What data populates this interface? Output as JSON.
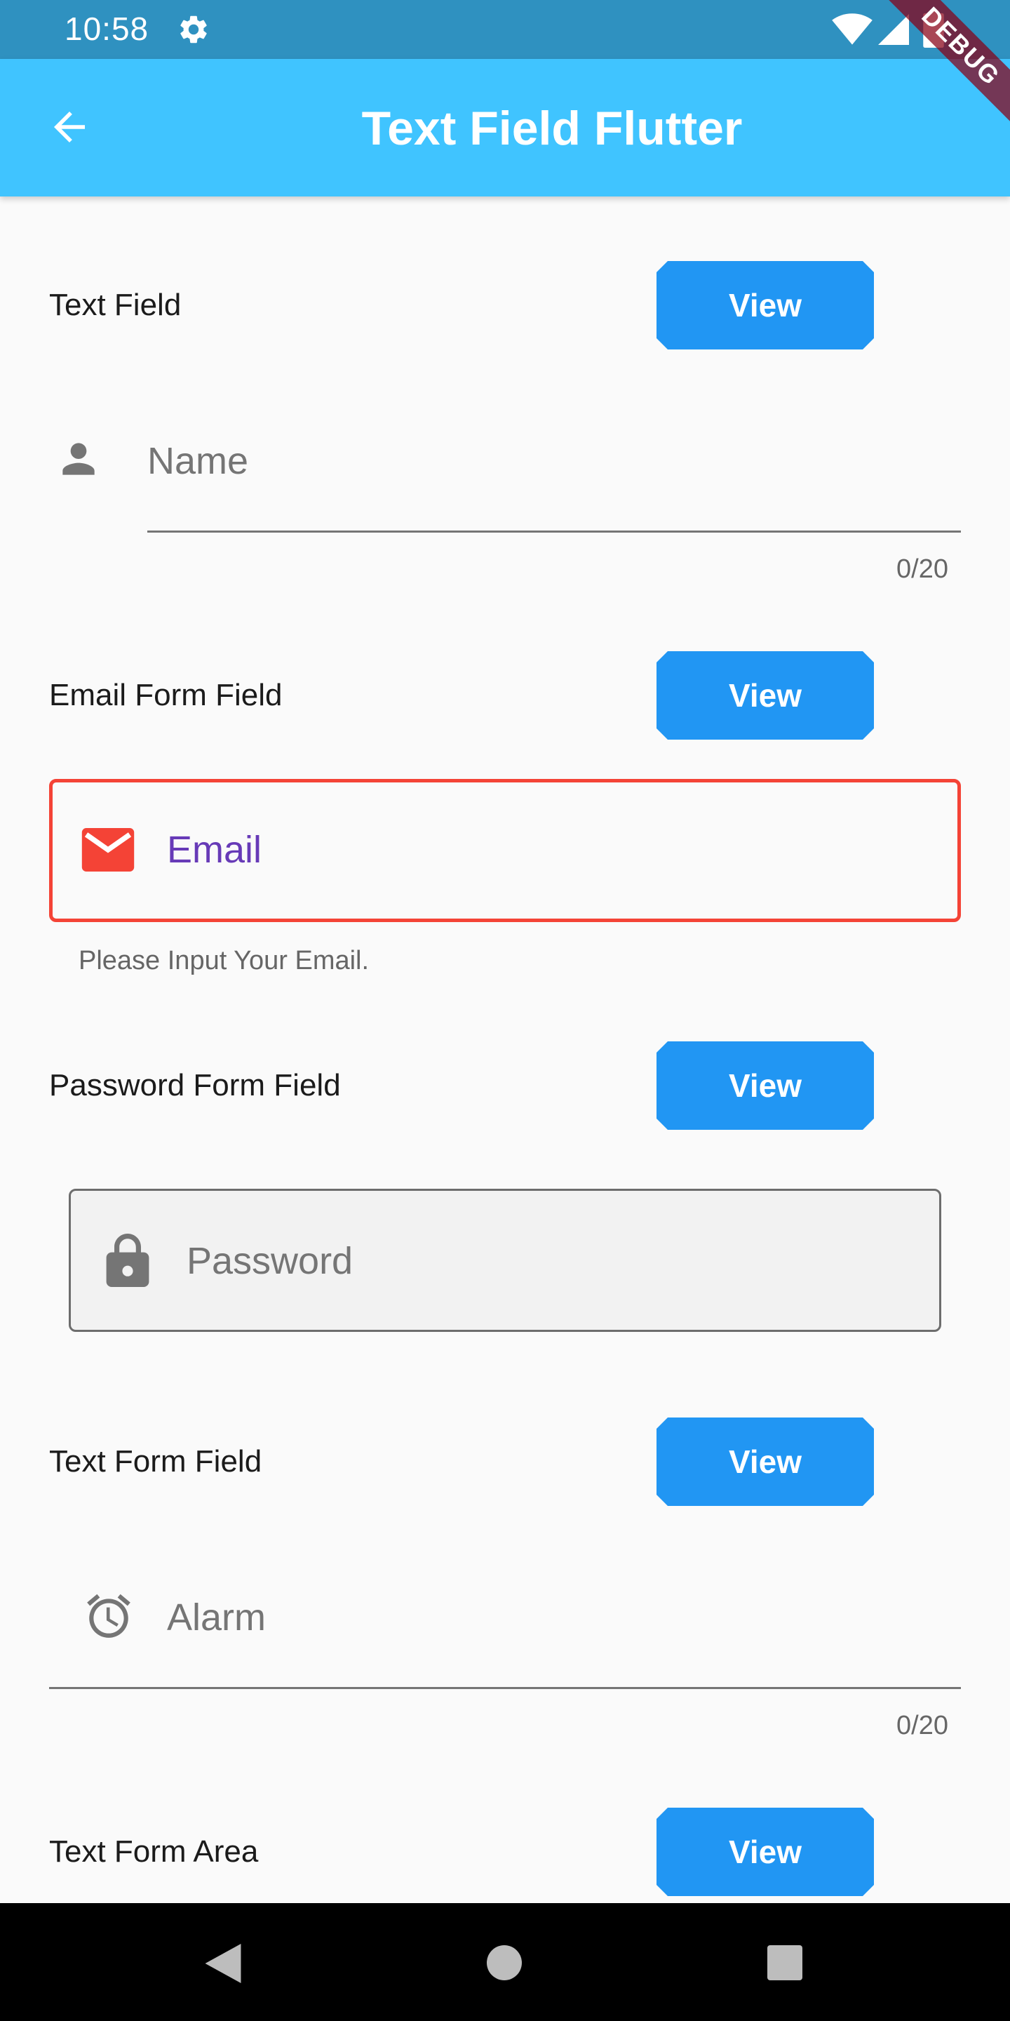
{
  "status_bar": {
    "time": "10:58",
    "icons": [
      "gear-icon",
      "wifi-icon",
      "signal-icon",
      "battery-icon"
    ]
  },
  "app_bar": {
    "title": "Text Field Flutter",
    "back_icon": "arrow-back-icon",
    "background": "#40c4ff"
  },
  "debug_banner": "DEBUG",
  "sections": {
    "text_field": {
      "label": "Text Field",
      "button": "View",
      "hint": "Name",
      "counter": "0/20",
      "icon": "person-icon"
    },
    "email_form_field": {
      "label": "Email Form Field",
      "button": "View",
      "field_label": "Email",
      "helper": "Please Input Your Email.",
      "icon": "email-icon",
      "border_color": "#f44336",
      "label_color": "#673ab7"
    },
    "password_form_field": {
      "label": "Password Form Field",
      "button": "View",
      "hint": "Password",
      "icon": "lock-icon"
    },
    "text_form_field": {
      "label": "Text Form Field",
      "button": "View",
      "hint": "Alarm",
      "counter": "0/20",
      "icon": "alarm-icon"
    },
    "text_form_area": {
      "label": "Text Form Area",
      "button": "View"
    }
  },
  "colors": {
    "button": "#2196f3",
    "status_bar": "#2f91c0"
  },
  "nav_bar": {
    "icons": [
      "nav-back-icon",
      "nav-home-icon",
      "nav-recent-icon"
    ]
  }
}
